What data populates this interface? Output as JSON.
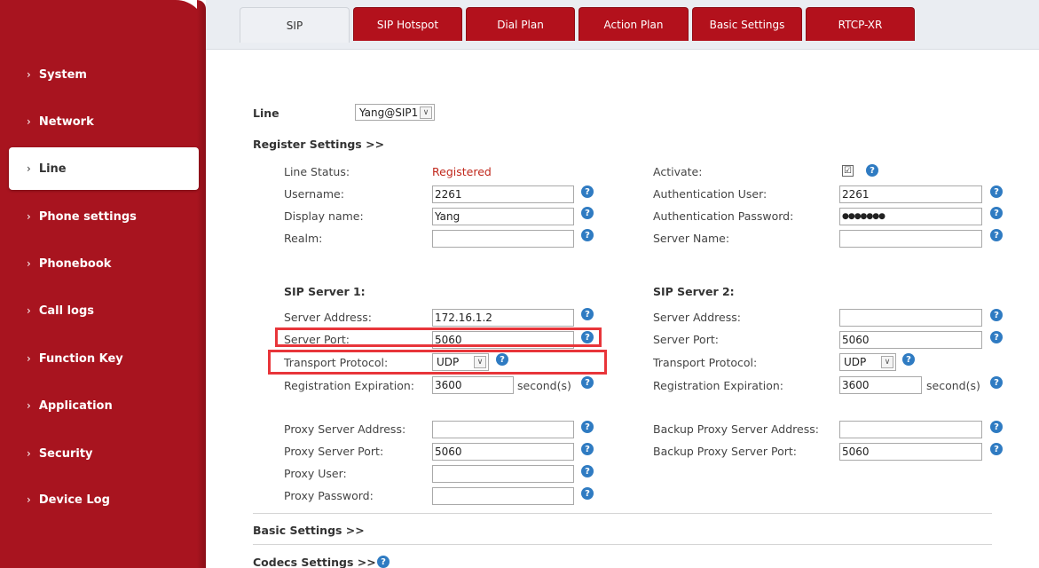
{
  "nav": [
    "System",
    "Network",
    "Line",
    "Phone settings",
    "Phonebook",
    "Call logs",
    "Function Key",
    "Application",
    "Security",
    "Device Log"
  ],
  "nav_chevron": "›",
  "tabs": [
    "SIP",
    "SIP Hotspot",
    "Dial Plan",
    "Action Plan",
    "Basic Settings",
    "RTCP-XR"
  ],
  "line": {
    "label": "Line",
    "value": "Yang@SIP1"
  },
  "register_header": "Register Settings >>",
  "left": {
    "line_status_label": "Line Status:",
    "line_status_value": "Registered",
    "username_label": "Username:",
    "username_value": "2261",
    "display_name_label": "Display name:",
    "display_name_value": "Yang",
    "realm_label": "Realm:",
    "realm_value": ""
  },
  "right": {
    "activate_label": "Activate:",
    "activate_checked": "☑",
    "auth_user_label": "Authentication User:",
    "auth_user_value": "2261",
    "auth_pass_label": "Authentication Password:",
    "auth_pass_value": "●●●●●●●",
    "server_name_label": "Server Name:",
    "server_name_value": ""
  },
  "sip1": {
    "header": "SIP Server 1:",
    "server_address_label": "Server Address:",
    "server_address_value": "172.16.1.2",
    "server_port_label": "Server Port:",
    "server_port_value": "5060",
    "transport_label": "Transport Protocol:",
    "transport_value": "UDP",
    "reg_exp_label": "Registration Expiration:",
    "reg_exp_value": "3600",
    "reg_exp_unit": "second(s)"
  },
  "sip2": {
    "header": "SIP Server 2:",
    "server_address_label": "Server Address:",
    "server_address_value": "",
    "server_port_label": "Server Port:",
    "server_port_value": "5060",
    "transport_label": "Transport Protocol:",
    "transport_value": "UDP",
    "reg_exp_label": "Registration Expiration:",
    "reg_exp_value": "3600",
    "reg_exp_unit": "second(s)"
  },
  "proxy": {
    "address_label": "Proxy Server Address:",
    "address_value": "",
    "port_label": "Proxy Server Port:",
    "port_value": "5060",
    "user_label": "Proxy User:",
    "user_value": "",
    "password_label": "Proxy Password:",
    "password_value": ""
  },
  "backup": {
    "address_label": "Backup Proxy Server Address:",
    "address_value": "",
    "port_label": "Backup Proxy Server Port:",
    "port_value": "5060"
  },
  "basic_settings_header": "Basic Settings >>",
  "codecs_header": "Codecs Settings >>",
  "help_glyph": "?",
  "dropdown_glyph": "∨",
  "colors": {
    "sidebar": "#a8141f",
    "tab": "#b3111c",
    "registered": "#c0281c",
    "help": "#2f7bc2",
    "highlight": "#e8353a"
  }
}
